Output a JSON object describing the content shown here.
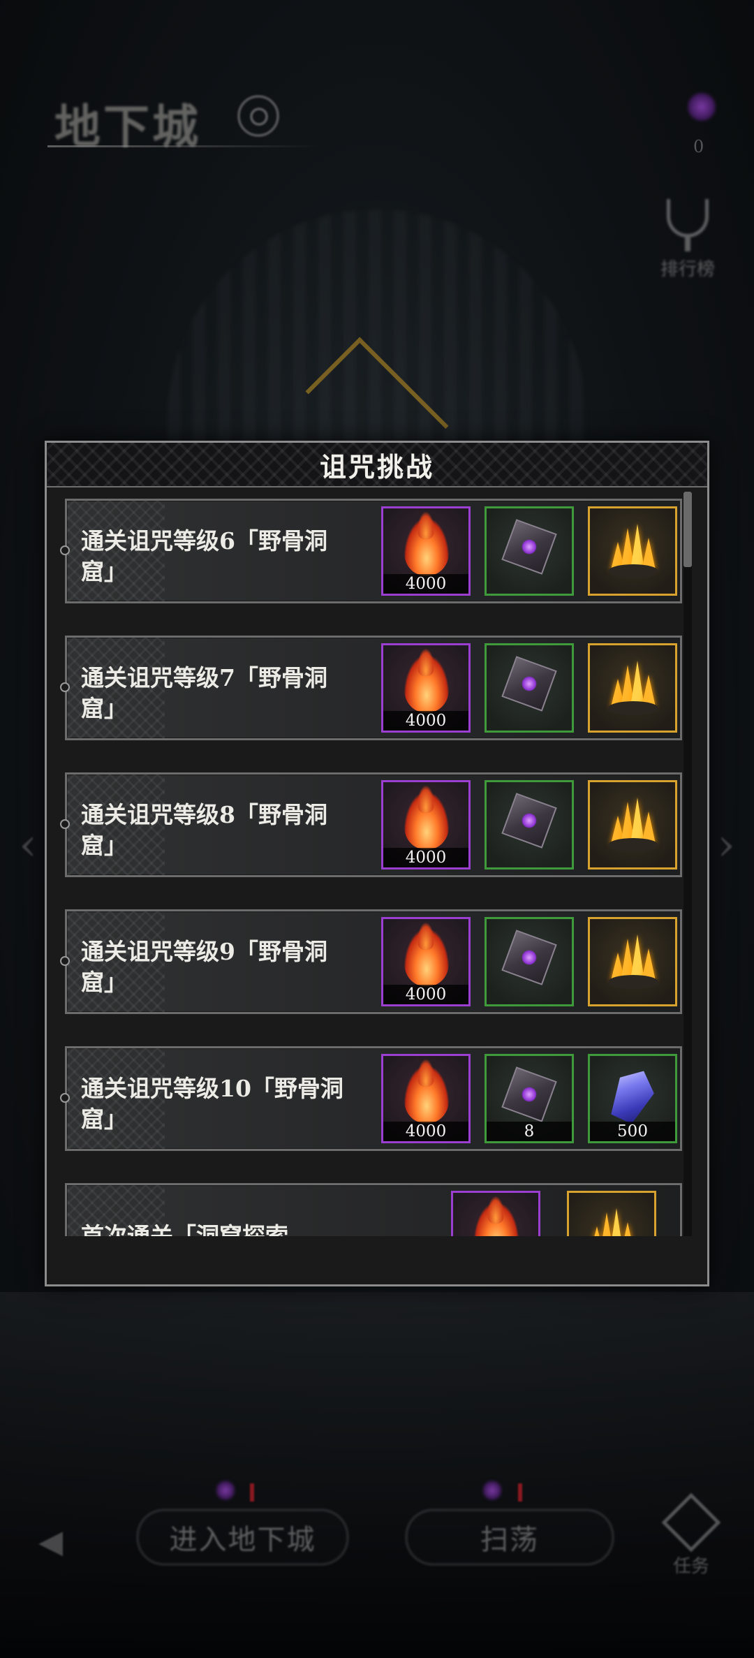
{
  "page": {
    "title": "地下城",
    "rank_label": "排行榜",
    "task_label": "任务",
    "top_right_count": "0"
  },
  "dialog": {
    "title": "诅咒挑战",
    "rows": [
      {
        "text": "通关诅咒等级6「野骨洞窟」",
        "rewards": [
          {
            "icon": "flame-icon",
            "rarity": "purple",
            "count": "4000"
          },
          {
            "icon": "rune-cube-icon",
            "rarity": "green",
            "count": ""
          },
          {
            "icon": "gold-crystal-icon",
            "rarity": "gold",
            "count": ""
          }
        ]
      },
      {
        "text": "通关诅咒等级7「野骨洞窟」",
        "rewards": [
          {
            "icon": "flame-icon",
            "rarity": "purple",
            "count": "4000"
          },
          {
            "icon": "rune-cube-icon",
            "rarity": "green",
            "count": ""
          },
          {
            "icon": "gold-crystal-icon",
            "rarity": "gold",
            "count": ""
          }
        ]
      },
      {
        "text": "通关诅咒等级8「野骨洞窟」",
        "rewards": [
          {
            "icon": "flame-icon",
            "rarity": "purple",
            "count": "4000"
          },
          {
            "icon": "rune-cube-icon",
            "rarity": "green",
            "count": ""
          },
          {
            "icon": "gold-crystal-icon",
            "rarity": "gold",
            "count": ""
          }
        ]
      },
      {
        "text": "通关诅咒等级9「野骨洞窟」",
        "rewards": [
          {
            "icon": "flame-icon",
            "rarity": "purple",
            "count": "4000"
          },
          {
            "icon": "rune-cube-icon",
            "rarity": "green",
            "count": ""
          },
          {
            "icon": "gold-crystal-icon",
            "rarity": "gold",
            "count": ""
          }
        ]
      },
      {
        "text": "通关诅咒等级10「野骨洞窟」",
        "rewards": [
          {
            "icon": "flame-icon",
            "rarity": "purple",
            "count": "4000"
          },
          {
            "icon": "rune-cube-icon",
            "rarity": "green",
            "count": "8"
          },
          {
            "icon": "blue-crystal-icon",
            "rarity": "green",
            "count": "500"
          }
        ]
      }
    ],
    "partial_row_text": "首次通关「洞窟探索"
  },
  "bottom": {
    "enter_button": "进入地下城",
    "sweep_button": "扫荡"
  },
  "colors": {
    "purple_frame": "#9a3fd0",
    "green_frame": "#3f9a3c",
    "gold_frame": "#d7a22d",
    "dialog_border": "#8c8c8c"
  }
}
